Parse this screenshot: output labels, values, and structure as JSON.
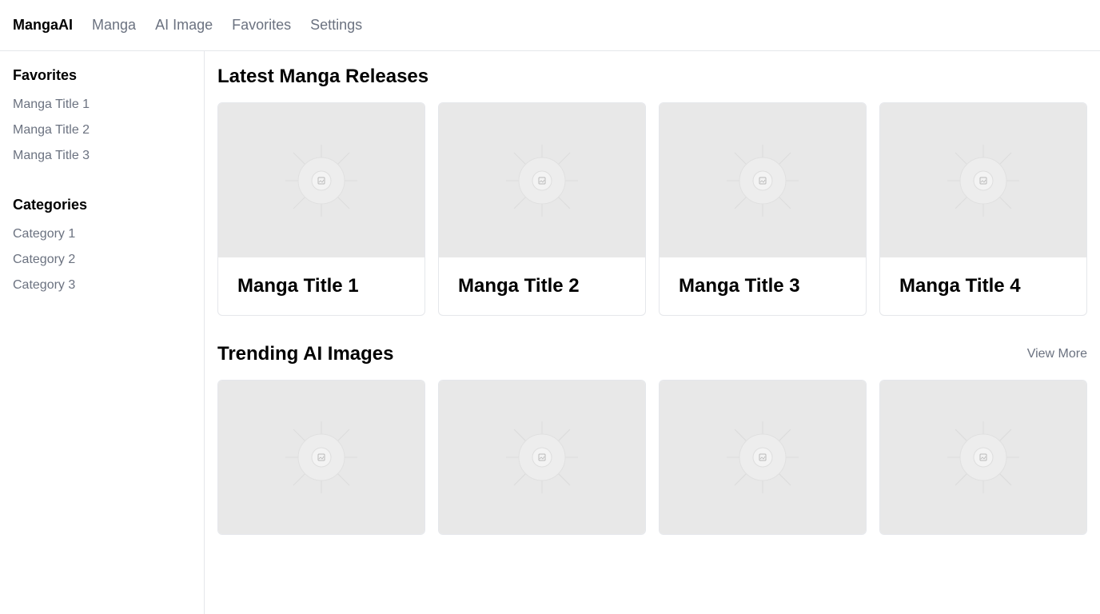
{
  "nav": {
    "brand": "MangaAI",
    "links": [
      "Manga",
      "AI Image",
      "Favorites",
      "Settings"
    ]
  },
  "sidebar": {
    "favorites": {
      "heading": "Favorites",
      "items": [
        "Manga Title 1",
        "Manga Title 2",
        "Manga Title 3"
      ]
    },
    "categories": {
      "heading": "Categories",
      "items": [
        "Category 1",
        "Category 2",
        "Category 3"
      ]
    }
  },
  "latest": {
    "title": "Latest Manga Releases",
    "cards": [
      "Manga Title 1",
      "Manga Title 2",
      "Manga Title 3",
      "Manga Title 4"
    ]
  },
  "trending": {
    "title": "Trending AI Images",
    "view_more": "View More",
    "count": 4
  },
  "colors": {
    "text_muted": "#6b7280",
    "border": "#e5e7eb",
    "placeholder_bg": "#e8e8e8"
  },
  "icons": {
    "image_placeholder": "image-placeholder-icon"
  }
}
